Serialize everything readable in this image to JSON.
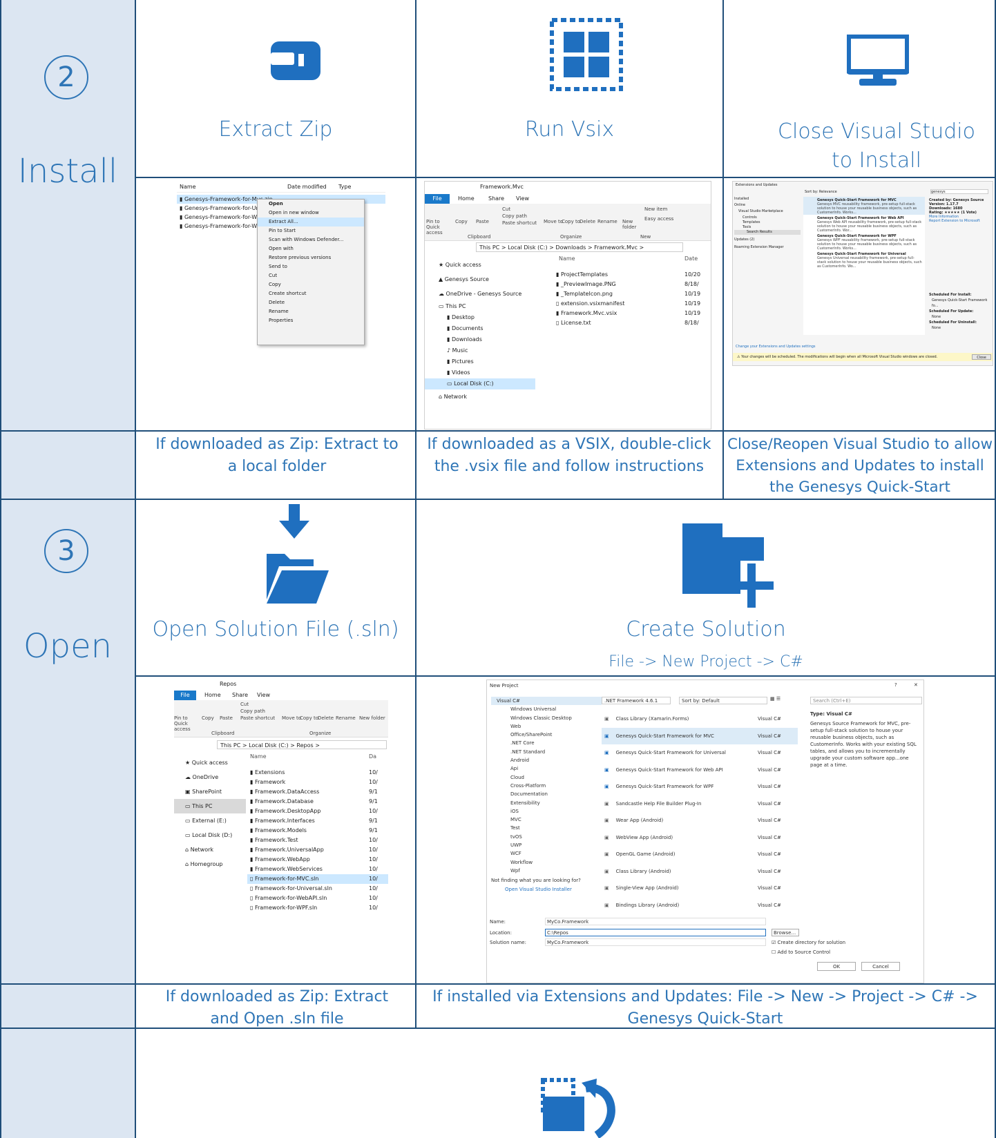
{
  "colors": {
    "accent": "#2e75b6",
    "icon": "#1f6fbf",
    "side": "#dce6f2",
    "border": "#1f4e79"
  },
  "steps": [
    {
      "number": "2",
      "label": "Install"
    },
    {
      "number": "3",
      "label": "Open"
    }
  ],
  "install": {
    "extract": {
      "icon": "extract-icon",
      "title": "Extract Zip",
      "caption": "If downloaded as Zip: Extract to a local folder"
    },
    "vsix": {
      "icon": "vsix-icon",
      "title": "Run Vsix",
      "caption": "If downloaded as a VSIX, double-click the .vsix file and follow instructions"
    },
    "close": {
      "icon": "monitor-icon",
      "title": "Close Visual Studio to Install",
      "caption": "Close/Reopen Visual Studio to allow Extensions and Updates to install the Genesys Quick-Start"
    }
  },
  "open": {
    "solution": {
      "icon": "open-folder-icon",
      "title": "Open Solution File (.sln)",
      "caption": "If downloaded as Zip: Extract and Open .sln file"
    },
    "create": {
      "icon": "new-folder-icon",
      "title": "Create Solution",
      "subtitle": "File -> New Project -> C#",
      "caption": "If installed via Extensions and Updates: File -> New -> Project -> C# -> Genesys Quick-Start"
    }
  },
  "shot_zip": {
    "headers": [
      "Name",
      "Date modified",
      "Type"
    ],
    "files": [
      "Genesys-Framework-for-Mvc.zip",
      "Genesys-Framework-for-Univer",
      "Genesys-Framework-for-WebAl",
      "Genesys-Framework-for-Wpf.zi"
    ],
    "menu": [
      "Open",
      "Open in new window",
      "Extract All...",
      "Pin to Start",
      "Scan with Windows Defender...",
      "Open with",
      "Restore previous versions",
      "Send to",
      "Cut",
      "Copy",
      "Create shortcut",
      "Delete",
      "Rename",
      "Properties"
    ]
  },
  "shot_vsix": {
    "title": "Framework.Mvc",
    "tabs": [
      "File",
      "Home",
      "Share",
      "View"
    ],
    "ribbon": [
      "Pin to Quick access",
      "Copy",
      "Paste",
      "Cut",
      "Copy path",
      "Paste shortcut",
      "Move to",
      "Copy to",
      "Delete",
      "Rename",
      "New folder",
      "New item",
      "Easy access"
    ],
    "groups": [
      "Clipboard",
      "Organize",
      "New"
    ],
    "path": "This PC  >  Local Disk (C:)  >  Downloads  >  Framework.Mvc  >",
    "nav": [
      "Quick access",
      "Genesys Source",
      "OneDrive - Genesys Source",
      "This PC",
      "Desktop",
      "Documents",
      "Downloads",
      "Music",
      "Pictures",
      "Videos",
      "Local Disk (C:)",
      "Network"
    ],
    "headers": [
      "Name",
      "Date"
    ],
    "files": [
      {
        "name": "ProjectTemplates",
        "date": "10/20"
      },
      {
        "name": "_PreviewImage.PNG",
        "date": "8/18/"
      },
      {
        "name": "_TemplateIcon.png",
        "date": "10/19"
      },
      {
        "name": "extension.vsixmanifest",
        "date": "10/19"
      },
      {
        "name": "Framework.Mvc.vsix",
        "date": "10/19"
      },
      {
        "name": "License.txt",
        "date": "8/18/"
      }
    ]
  },
  "shot_ext": {
    "title": "Extensions and Updates",
    "sort": "Sort by: Relevance",
    "search": "genesys",
    "nav": [
      "Installed",
      "Online",
      "Visual Studio Marketplace",
      "Controls",
      "Templates",
      "Tools",
      "Search Results",
      "Updates (2)",
      "Roaming Extension Manager"
    ],
    "items": [
      {
        "title": "Genesys Quick-Start Framework for MVC",
        "desc": "Genesys MVC reusability framework, pre-setup full-stack solution to house your reusable business objects, such as CustomerInfo. Works..."
      },
      {
        "title": "Genesys Quick-Start Framework for Web API",
        "desc": "Genesys Web API reusability framework, pre-setup full-stack solution to house your reusable business objects, such as CustomerInfo. Wor..."
      },
      {
        "title": "Genesys Quick-Start Framework for WPF",
        "desc": "Genesys WPF reusability framework, pre-setup full-stack solution to house your reusable business objects, such as CustomerInfo. Works..."
      },
      {
        "title": "Genesys Quick-Start Framework for Universal",
        "desc": "Genesys Universal reusability framework, pre-setup full-stack solution to house your reusable business objects, such as CustomerInfo. Wo..."
      }
    ],
    "details": [
      "Created by: Genesys Source",
      "Version: 1.17.7",
      "Downloads: 1680",
      "Rating: ★★★★★ (1 Vote)",
      "More Information",
      "Report Extension to Microsoft"
    ],
    "scheduled": [
      "Scheduled For Install:",
      "Genesys Quick-Start Framework fo...",
      "Scheduled For Update:",
      "None",
      "Scheduled For Uninstall:",
      "None"
    ],
    "footer_link": "Change your Extensions and Updates settings",
    "warning": "Your changes will be scheduled. The modifications will begin when all Microsoft Visual Studio windows are closed.",
    "close": "Close"
  },
  "shot_repos": {
    "title": "Repos",
    "tabs": [
      "File",
      "Home",
      "Share",
      "View"
    ],
    "ribbon": [
      "Pin to Quick access",
      "Copy",
      "Paste",
      "Cut",
      "Copy path",
      "Paste shortcut",
      "Move to",
      "Copy to",
      "Delete",
      "Rename",
      "New folder"
    ],
    "groups": [
      "Clipboard",
      "Organize"
    ],
    "path": "This PC  >  Local Disk (C:)  >  Repos  >",
    "nav": [
      "Quick access",
      "OneDrive",
      "SharePoint",
      "This PC",
      "External (E:)",
      "Local Disk (D:)",
      "Network",
      "Homegroup"
    ],
    "headers": [
      "Name",
      "Da"
    ],
    "files": [
      {
        "name": "Extensions",
        "date": "10/"
      },
      {
        "name": "Framework",
        "date": "10/"
      },
      {
        "name": "Framework.DataAccess",
        "date": "9/1"
      },
      {
        "name": "Framework.Database",
        "date": "9/1"
      },
      {
        "name": "Framework.DesktopApp",
        "date": "10/"
      },
      {
        "name": "Framework.Interfaces",
        "date": "9/1"
      },
      {
        "name": "Framework.Models",
        "date": "9/1"
      },
      {
        "name": "Framework.Test",
        "date": "10/"
      },
      {
        "name": "Framework.UniversalApp",
        "date": "10/"
      },
      {
        "name": "Framework.WebApp",
        "date": "10/"
      },
      {
        "name": "Framework.WebServices",
        "date": "10/"
      },
      {
        "name": "Framework-for-MVC.sln",
        "date": "10/"
      },
      {
        "name": "Framework-for-Universal.sln",
        "date": "10/"
      },
      {
        "name": "Framework-for-WebAPI.sln",
        "date": "10/"
      },
      {
        "name": "Framework-for-WPF.sln",
        "date": "10/"
      }
    ]
  },
  "shot_newproj": {
    "title": "New Project",
    "framework": ".NET Framework 4.6.1",
    "sort": "Sort by:  Default",
    "search": "Search (Ctrl+E)",
    "tree": [
      "Visual C#",
      "Windows Universal",
      "Windows Classic Desktop",
      "Web",
      "Office/SharePoint",
      ".NET Core",
      ".NET Standard",
      "Android",
      "Api",
      "Cloud",
      "Cross-Platform",
      "Documentation",
      "Extensibility",
      "iOS",
      "MVC",
      "Test",
      "tvOS",
      "UWP",
      "WCF",
      "Workflow",
      "Wpf"
    ],
    "not_finding": "Not finding what you are looking for?",
    "installer": "Open Visual Studio Installer",
    "templates": [
      "Class Library (Xamarin.Forms)",
      "Genesys Quick-Start Framework for MVC",
      "Genesys Quick-Start Framework for Universal",
      "Genesys Quick-Start Framework for Web API",
      "Genesys Quick-Start Framework for WPF",
      "Sandcastle Help File Builder Plug-In",
      "Wear App (Android)",
      "WebView App (Android)",
      "OpenGL Game (Android)",
      "Class Library (Android)",
      "Single-View App (Android)",
      "Bindings Library (Android)"
    ],
    "lang": "Visual C#",
    "type_label": "Type:  Visual C#",
    "desc": "Genesys Source Framework for MVC, pre-setup full-stack solution to house your reusable business objects, such as CustomerInfo. Works with your existing SQL tables, and allows you to incrementally upgrade your custom software app...one page at a time.",
    "name_label": "Name:",
    "name_value": "MyCo.Framework",
    "location_label": "Location:",
    "location_value": "C:\\Repos",
    "solution_label": "Solution name:",
    "solution_value": "MyCo.Framework",
    "browse": "Browse...",
    "create_dir": "Create directory for solution",
    "source_control": "Add to Source Control",
    "ok": "OK",
    "cancel": "Cancel"
  }
}
